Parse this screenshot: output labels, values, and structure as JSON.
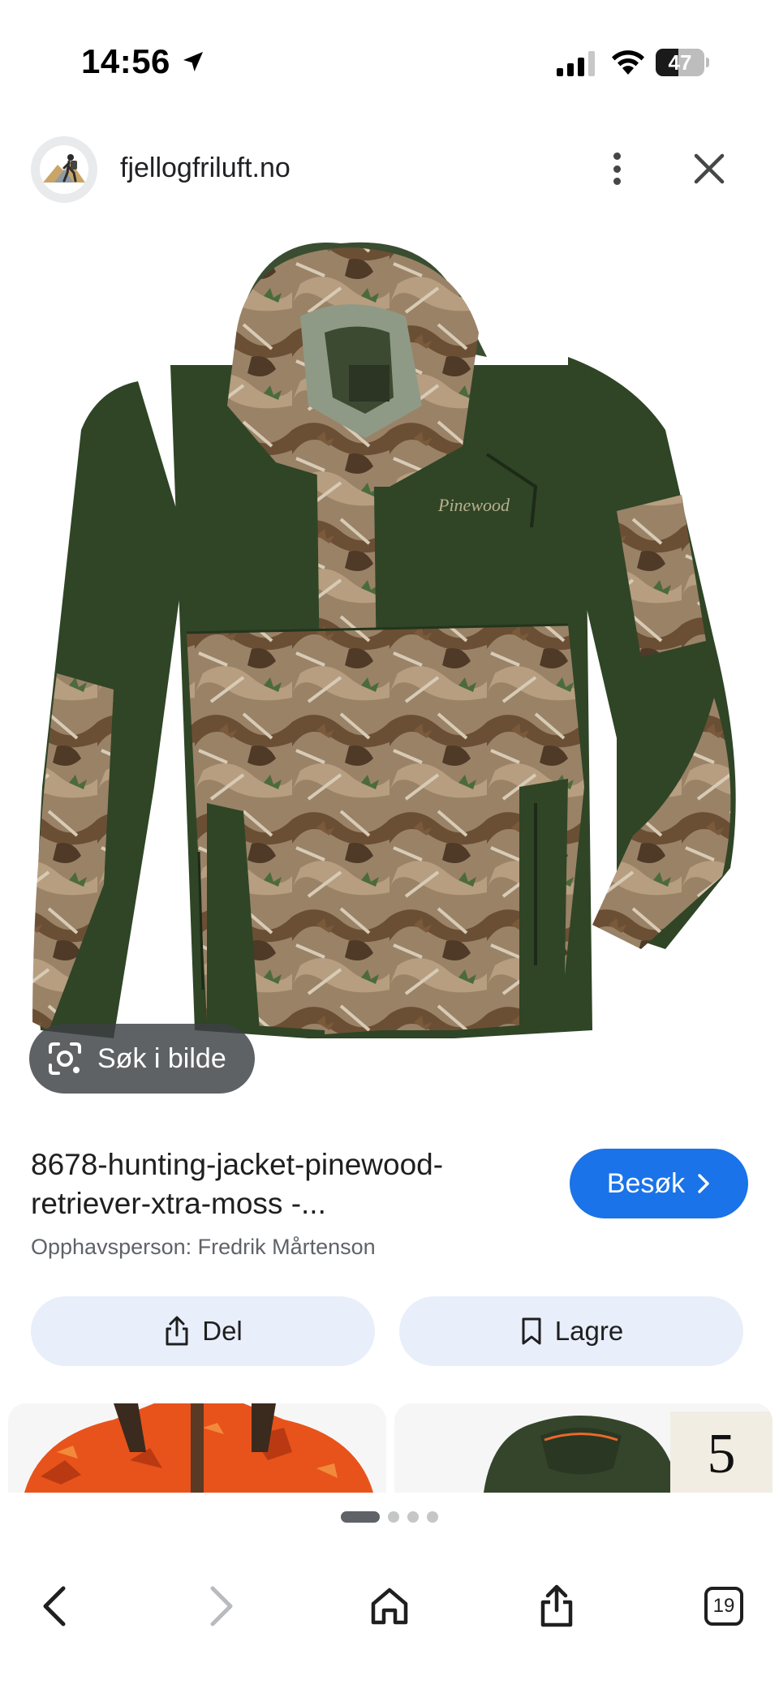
{
  "status_bar": {
    "time": "14:56",
    "battery": "47",
    "battery_level_percent": 47,
    "icons": [
      "location-arrow-icon",
      "cellular-signal-icon",
      "wifi-icon",
      "battery-icon"
    ]
  },
  "header": {
    "site_name": "fjellogfriluft.no",
    "icons": [
      "site-logo",
      "more-vert-icon",
      "close-icon"
    ]
  },
  "image": {
    "lens_label": "Søk i bilde",
    "lens_icon": "google-lens-icon",
    "brand_mark": "Pinewood"
  },
  "result": {
    "title_line1": "8678-hunting-jacket-pinewood-",
    "title_line2": "retriever-xtra-moss -...",
    "credit": "Opphavsperson: Fredrik Mårtenson",
    "visit_label": "Besøk"
  },
  "actions": {
    "share_label": "Del",
    "save_label": "Lagre"
  },
  "related": {
    "thumb2_text": "5"
  },
  "pager": {
    "pages": 4,
    "active": 1
  },
  "nav": {
    "tab_count": "19",
    "icons": [
      "back-icon",
      "forward-icon",
      "home-icon",
      "share-icon",
      "tabs-icon"
    ]
  },
  "colors": {
    "accent": "#1a73e8",
    "chip_bg": "#e8eefa",
    "jacket_green": "#2f4526",
    "camo_brown": "#8a6a4a"
  }
}
